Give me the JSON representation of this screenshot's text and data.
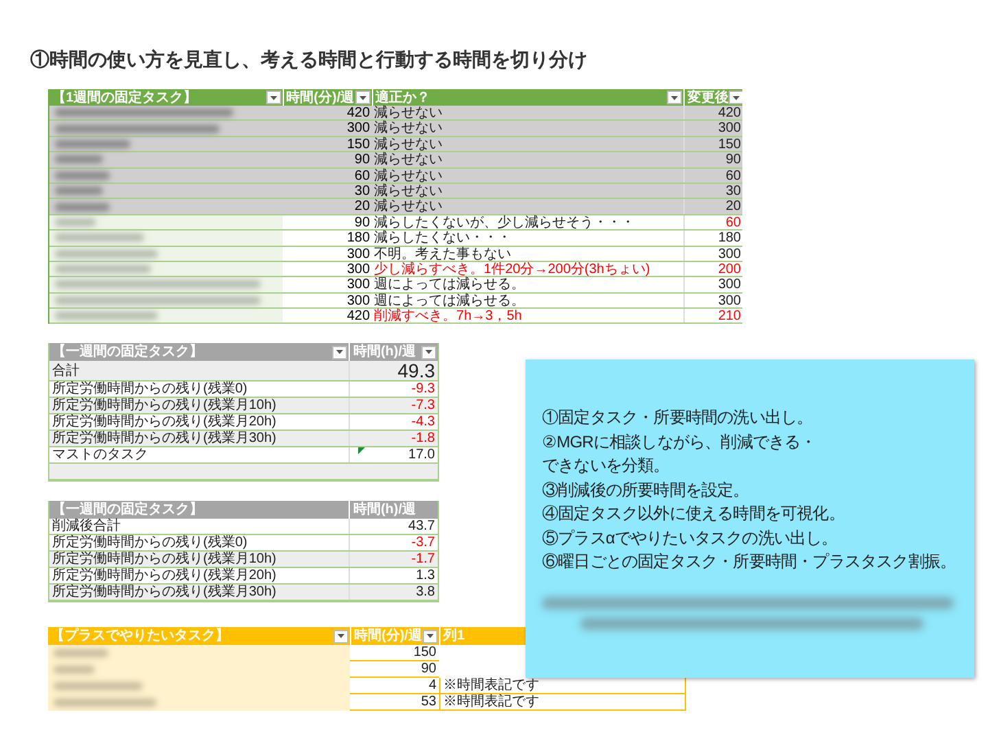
{
  "title": "①時間の使い方を見直し、考える時間と行動する時間を切り分け",
  "fixed_tasks": {
    "columns": [
      "【1週間の固定タスク】",
      "時間(分)/週",
      "適正か？",
      "変更後"
    ],
    "rows": [
      {
        "shaded": true,
        "time": "420",
        "comment": "減らせない",
        "comment_red": false,
        "after": "420",
        "after_red": false
      },
      {
        "shaded": true,
        "time": "300",
        "comment": "減らせない",
        "comment_red": false,
        "after": "300",
        "after_red": false
      },
      {
        "shaded": true,
        "time": "150",
        "comment": "減らせない",
        "comment_red": false,
        "after": "150",
        "after_red": false
      },
      {
        "shaded": true,
        "time": "90",
        "comment": "減らせない",
        "comment_red": false,
        "after": "90",
        "after_red": false
      },
      {
        "shaded": true,
        "time": "60",
        "comment": "減らせない",
        "comment_red": false,
        "after": "60",
        "after_red": false
      },
      {
        "shaded": true,
        "time": "30",
        "comment": "減らせない",
        "comment_red": false,
        "after": "30",
        "after_red": false
      },
      {
        "shaded": true,
        "time": "20",
        "comment": "減らせない",
        "comment_red": false,
        "after": "20",
        "after_red": false
      },
      {
        "shaded": false,
        "time": "90",
        "comment": "減らしたくないが、少し減らせそう・・・",
        "comment_red": false,
        "after": "60",
        "after_red": true
      },
      {
        "shaded": false,
        "time": "180",
        "comment": "減らしたくない・・・",
        "comment_red": false,
        "after": "180",
        "after_red": false
      },
      {
        "shaded": false,
        "time": "300",
        "comment": "不明。考えた事もない",
        "comment_red": false,
        "after": "300",
        "after_red": false
      },
      {
        "shaded": false,
        "time": "300",
        "comment": "少し減らすべき。1件20分→200分(3hちょい)",
        "comment_red": true,
        "after": "200",
        "after_red": true
      },
      {
        "shaded": false,
        "time": "300",
        "comment": "週によっては減らせる。",
        "comment_red": false,
        "after": "300",
        "after_red": false
      },
      {
        "shaded": false,
        "time": "300",
        "comment": "週によっては減らせる。",
        "comment_red": false,
        "after": "300",
        "after_red": false
      },
      {
        "shaded": false,
        "time": "420",
        "comment": "削減すべき。7h→3，5h",
        "comment_red": true,
        "after": "210",
        "after_red": true
      }
    ]
  },
  "weekly_summary": {
    "columns": [
      "【一週間の固定タスク】",
      "時間(h)/週"
    ],
    "filters": true,
    "rows": [
      {
        "kind": "total",
        "label": "合計",
        "value": "49.3",
        "shaded": true,
        "negative": false
      },
      {
        "kind": "row",
        "label": "所定労働時間からの残り(残業0)",
        "value": "-9.3",
        "shaded": false,
        "negative": true
      },
      {
        "kind": "row",
        "label": "所定労働時間からの残り(残業月10h)",
        "value": "-7.3",
        "shaded": true,
        "negative": true
      },
      {
        "kind": "row",
        "label": "所定労働時間からの残り(残業月20h)",
        "value": "-4.3",
        "shaded": false,
        "negative": true
      },
      {
        "kind": "row",
        "label": "所定労働時間からの残り(残業月30h)",
        "value": "-1.8",
        "shaded": true,
        "negative": true
      },
      {
        "kind": "row",
        "label": "マストのタスク",
        "value": "17.0",
        "shaded": false,
        "negative": false,
        "flagged": true
      },
      {
        "kind": "empty",
        "shaded": true
      }
    ]
  },
  "after_summary": {
    "columns": [
      "【一週間の固定タスク】",
      "時間(h)/週"
    ],
    "filters": false,
    "rows": [
      {
        "kind": "row",
        "label": "削減後合計",
        "value": "43.7",
        "shaded": false,
        "negative": false
      },
      {
        "kind": "row",
        "label": "所定労働時間からの残り(残業0)",
        "value": "-3.7",
        "shaded": false,
        "negative": true
      },
      {
        "kind": "row",
        "label": "所定労働時間からの残り(残業月10h)",
        "value": "-1.7",
        "shaded": true,
        "negative": true
      },
      {
        "kind": "row",
        "label": "所定労働時間からの残り(残業月20h)",
        "value": "1.3",
        "shaded": false,
        "negative": false
      },
      {
        "kind": "row",
        "label": "所定労働時間からの残り(残業月30h)",
        "value": "3.8",
        "shaded": true,
        "negative": false
      }
    ]
  },
  "plus_tasks": {
    "columns": [
      "【プラスでやりたいタスク】",
      "時間(分)/週",
      "列1"
    ],
    "rows": [
      {
        "time": "150"
      },
      {
        "time": "90"
      },
      {
        "time": "4",
        "note": "※時間表記です"
      },
      {
        "time": "53",
        "note": "※時間表記です"
      }
    ]
  },
  "callout": {
    "lines": [
      "①固定タスク・所要時間の洗い出し。",
      "②MGRに相談しながら、削減できる・",
      "できないを分類。",
      "③削減後の所要時間を設定。",
      "④固定タスク以外に使える時間を可視化。",
      "⑤プラスαでやりたいタスクの洗い出し。",
      "⑥曜日ごとの固定タスク・所要時間・プラスタスク割振。"
    ]
  }
}
